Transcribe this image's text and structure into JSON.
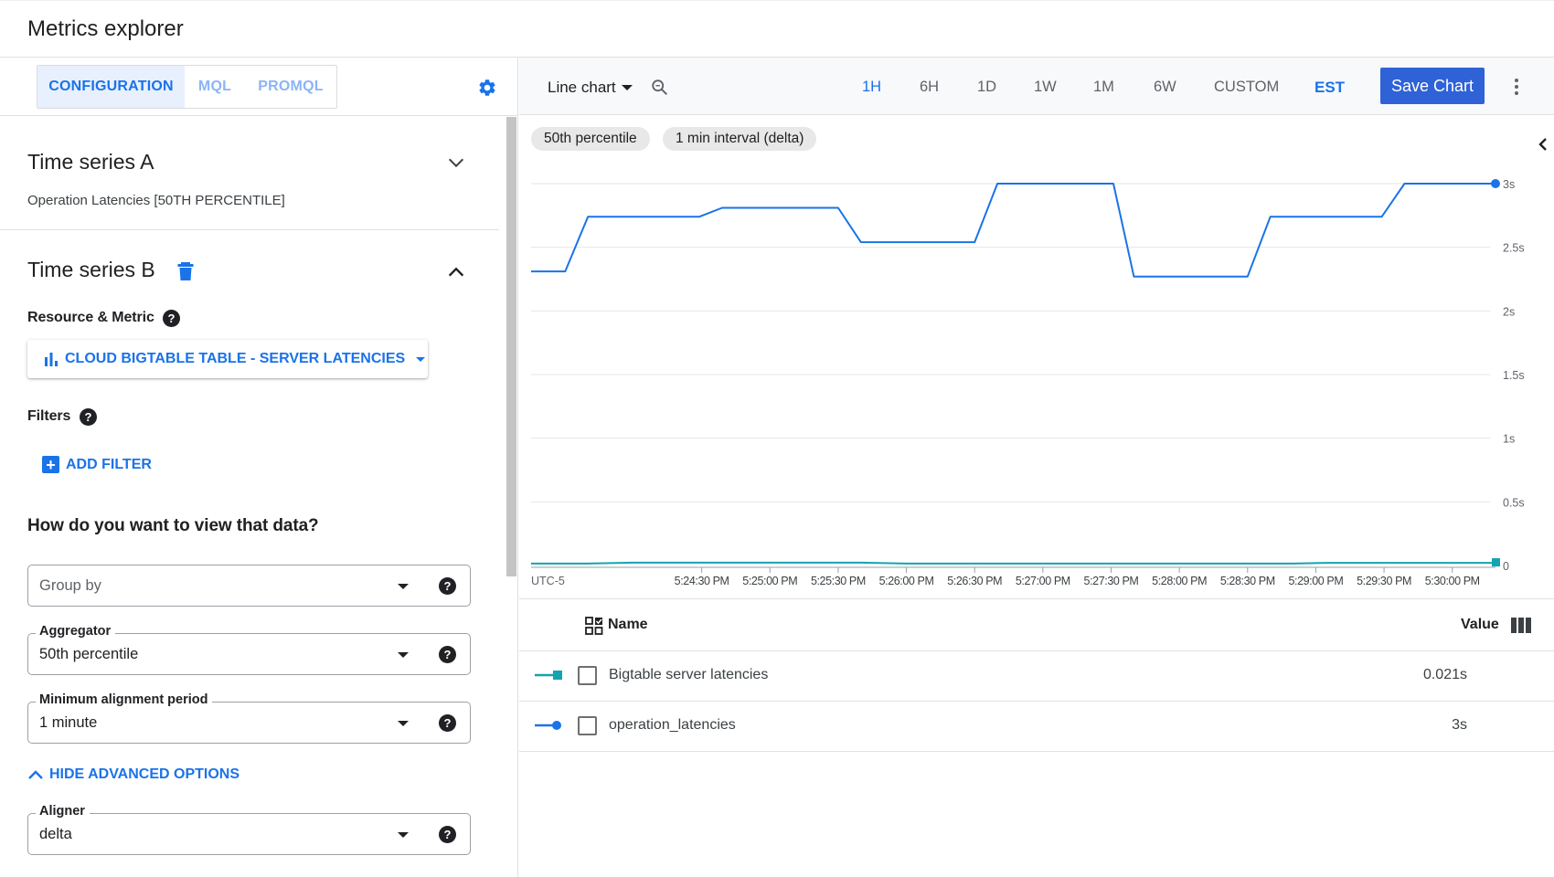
{
  "header": {
    "title": "Metrics explorer"
  },
  "left_panel": {
    "tabs": [
      {
        "label": "CONFIGURATION",
        "active": true
      },
      {
        "label": "MQL",
        "active": false
      },
      {
        "label": "PROMQL",
        "active": false
      }
    ],
    "settings_icon": "gear-icon",
    "time_series_a": {
      "title": "Time series A",
      "summary": "Operation Latencies [50TH PERCENTILE]",
      "expanded": false
    },
    "time_series_b": {
      "title": "Time series B",
      "expanded": true,
      "resource_metric_label": "Resource & Metric",
      "metric_button": "CLOUD BIGTABLE TABLE - SERVER LATENCIES",
      "filters_label": "Filters",
      "add_filter": "ADD FILTER",
      "view_question": "How do you want to view that data?",
      "group_by": {
        "placeholder": "Group by",
        "value": ""
      },
      "aggregator": {
        "label": "Aggregator",
        "value": "50th percentile"
      },
      "alignment_period": {
        "label": "Minimum alignment period",
        "value": "1 minute"
      },
      "advanced_toggle": "HIDE ADVANCED OPTIONS",
      "aligner": {
        "label": "Aligner",
        "value": "delta"
      }
    },
    "help_glyph": "?"
  },
  "chart_panel": {
    "chart_type": "Line chart",
    "time_ranges": [
      {
        "label": "1H",
        "active": true
      },
      {
        "label": "6H",
        "active": false
      },
      {
        "label": "1D",
        "active": false
      },
      {
        "label": "1W",
        "active": false
      },
      {
        "label": "1M",
        "active": false
      },
      {
        "label": "6W",
        "active": false
      },
      {
        "label": "CUSTOM",
        "active": false
      }
    ],
    "timezone": "EST",
    "save_button": "Save Chart",
    "chips": [
      "50th percentile",
      "1 min interval (delta)"
    ],
    "colors": {
      "accent": "#1a73e8",
      "save_button": "#2f62d6",
      "operation_latencies": "#1a73e8",
      "bigtable_latencies": "#12a4af"
    }
  },
  "legend": {
    "name_header": "Name",
    "value_header": "Value",
    "rows": [
      {
        "marker": "square",
        "color": "#12a4af",
        "name": "Bigtable server latencies",
        "value": "0.021s"
      },
      {
        "marker": "circle",
        "color": "#1a73e8",
        "name": "operation_latencies",
        "value": "3s"
      }
    ]
  },
  "chart_data": {
    "type": "line",
    "title": "",
    "xlabel": "",
    "ylabel": "",
    "timezone_label": "UTC-5",
    "x_ticks": [
      "5:24:30 PM",
      "5:25:00 PM",
      "5:25:30 PM",
      "5:26:00 PM",
      "5:26:30 PM",
      "5:27:00 PM",
      "5:27:30 PM",
      "5:28:00 PM",
      "5:28:30 PM",
      "5:29:00 PM",
      "5:29:30 PM",
      "5:30:00 PM"
    ],
    "x_tick_seconds": [
      1470,
      1500,
      1530,
      1560,
      1590,
      1620,
      1650,
      1680,
      1710,
      1740,
      1770,
      1800
    ],
    "x_unit": "seconds past 5:00:00 PM",
    "xlim": [
      1395,
      1819
    ],
    "y_ticks": [
      "0",
      "0.5s",
      "1s",
      "1.5s",
      "2s",
      "2.5s",
      "3s"
    ],
    "y_tick_values": [
      0,
      0.5,
      1,
      1.5,
      2,
      2.5,
      3
    ],
    "ylim": [
      0,
      3
    ],
    "y_axis_position": "right",
    "grid": true,
    "series": [
      {
        "name": "operation_latencies",
        "color": "#1a73e8",
        "end_marker": "circle",
        "x": [
          1395,
          1410,
          1420,
          1469,
          1479,
          1530,
          1540,
          1590,
          1600,
          1651,
          1660,
          1710,
          1720,
          1769,
          1779,
          1819
        ],
        "values": [
          2.31,
          2.31,
          2.74,
          2.74,
          2.81,
          2.81,
          2.54,
          2.54,
          3.0,
          3.0,
          2.27,
          2.27,
          2.74,
          2.74,
          3.0,
          3.0
        ]
      },
      {
        "name": "Bigtable server latencies",
        "color": "#12a4af",
        "end_marker": "square",
        "x": [
          1395,
          1420,
          1440,
          1540,
          1560,
          1730,
          1745,
          1819
        ],
        "values": [
          0.015,
          0.015,
          0.022,
          0.022,
          0.015,
          0.015,
          0.021,
          0.021
        ]
      }
    ]
  }
}
